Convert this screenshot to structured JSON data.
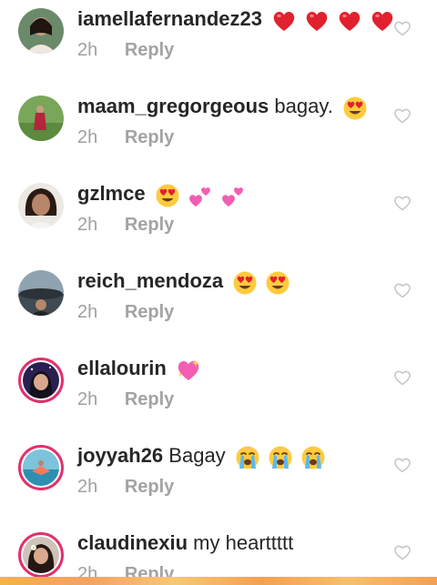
{
  "comments": [
    {
      "username": "iamellafernandez23",
      "text": "",
      "emojis": [
        "red-heart",
        "red-heart",
        "red-heart",
        "red-heart"
      ],
      "time": "2h",
      "reply": "Reply",
      "story_ring": false,
      "avatar_color": "#6b8a6a"
    },
    {
      "username": "maam_gregorgeous",
      "text": "bagay.",
      "emojis": [
        "heart-eyes"
      ],
      "time": "2h",
      "reply": "Reply",
      "story_ring": false,
      "avatar_color": "#7aa65a"
    },
    {
      "username": "gzlmce",
      "text": "",
      "emojis": [
        "heart-eyes",
        "two-hearts",
        "two-hearts"
      ],
      "time": "2h",
      "reply": "Reply",
      "story_ring": false,
      "avatar_color": "#3a2a25"
    },
    {
      "username": "reich_mendoza",
      "text": "",
      "emojis": [
        "heart-eyes",
        "heart-eyes"
      ],
      "time": "2h",
      "reply": "Reply",
      "story_ring": false,
      "avatar_color": "#5b6f7c"
    },
    {
      "username": "ellalourin",
      "text": "",
      "emojis": [
        "sparkling-heart"
      ],
      "time": "2h",
      "reply": "Reply",
      "story_ring": true,
      "avatar_color": "#2a2050"
    },
    {
      "username": "joyyah26",
      "text": "Bagay",
      "emojis": [
        "loudly-crying",
        "loudly-crying",
        "loudly-crying"
      ],
      "time": "2h",
      "reply": "Reply",
      "story_ring": true,
      "avatar_color": "#3d9bb5"
    },
    {
      "username": "claudinexiu",
      "text": "my hearttttt",
      "emojis": [],
      "time": "2h",
      "reply": "Reply",
      "story_ring": true,
      "avatar_color": "#9a7a6a"
    }
  ],
  "colors": {
    "username": "#262626",
    "meta": "#a0a0a0",
    "story_ring": "#e1306c",
    "like_outline": "#c7c7c7"
  },
  "icons": {
    "like": "heart-outline-icon"
  }
}
